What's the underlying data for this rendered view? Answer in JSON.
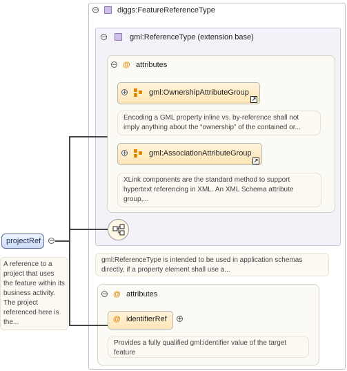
{
  "root": {
    "name": "projectRef",
    "doc": "A reference to a project that uses the feature within its business activity. The project referenced here is the..."
  },
  "type": {
    "name": "diggs:FeatureReferenceType"
  },
  "base": {
    "name": "gml:ReferenceType (extension base)",
    "attributes_title": "attributes",
    "groups": [
      {
        "name": "gml:OwnershipAttributeGroup",
        "doc": "Encoding a GML property inline vs. by-reference shall not imply anything about the “ownership” of the contained or..."
      },
      {
        "name": "gml:AssociationAttributeGroup",
        "doc": "XLink components are the standard method to support hypertext referencing in XML. An XML Schema attribute group,..."
      }
    ],
    "doc": "gml:ReferenceType is intended to be used in application schemas directly, if a property element shall use a..."
  },
  "own_attributes": {
    "title": "attributes",
    "attr_name": "identifierRef",
    "attr_doc": "Provides a fully qualified gml:identifier value of the target feature"
  },
  "icons": {
    "toggle_minus": "⊖",
    "toggle_plus": "⊕",
    "at_symbol": "@",
    "link_arrow": "↗"
  },
  "colors": {
    "root_fill": "#dfe9fb",
    "group_fill": "#fde6b8",
    "type_square": "#cdbde8",
    "attr_accent": "#e08a00"
  }
}
